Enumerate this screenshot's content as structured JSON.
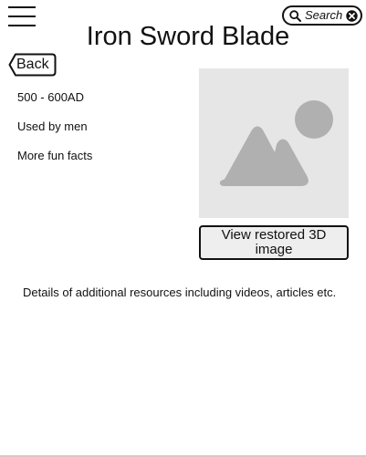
{
  "header": {
    "menu_icon": "hamburger-menu-icon",
    "search": {
      "label": "Search",
      "icon": "search-icon",
      "clear_icon": "close-circle-icon"
    },
    "title": "Iron Sword Blade"
  },
  "nav": {
    "back_label": "Back"
  },
  "facts": [
    "500 - 600AD",
    "Used by men",
    "More fun facts"
  ],
  "media": {
    "image_icon": "image-placeholder-icon",
    "view_button_label": "View restored 3D image"
  },
  "resources_text": "Details of additional resources including videos, articles etc.",
  "colors": {
    "text": "#111111",
    "placeholder_bg": "#e6e6e6",
    "placeholder_fg": "#b0b0b0",
    "button_bg": "#eeeeee"
  }
}
